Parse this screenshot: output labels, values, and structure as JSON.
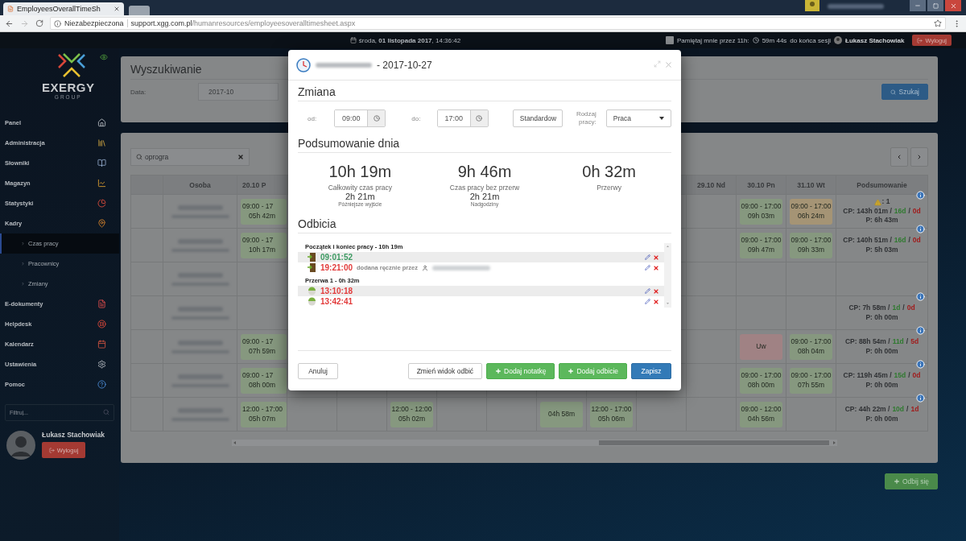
{
  "browser": {
    "tab_title": "EmployeesOverallTimeSh",
    "security": "Niezabezpieczona",
    "url_host": "support.xgg.com.pl",
    "url_path": "/humanresources/employeesoveralltimesheet.aspx"
  },
  "topbar": {
    "date": "środa, **01 listopada 2017**, 14:36:42",
    "remember_checked": false,
    "remember": "Pamiętaj mnie przez 11h:",
    "timer": "59m 44s",
    "timer_suffix": "do końca sesji",
    "user": "Łukasz Stachowiak",
    "logout": "Wyloguj"
  },
  "sidebar": {
    "brand": "EXERGY",
    "brand_sub": "GROUP",
    "items": [
      {
        "label": "Panel"
      },
      {
        "label": "Administracja"
      },
      {
        "label": "Słowniki"
      },
      {
        "label": "Magazyn"
      },
      {
        "label": "Statystyki"
      },
      {
        "label": "Kadry",
        "children": [
          {
            "label": "Czas pracy",
            "selected": true
          },
          {
            "label": "Pracownicy",
            "selected": false
          },
          {
            "label": "Zmiany",
            "selected": false
          }
        ]
      },
      {
        "label": "E-dokumenty"
      },
      {
        "label": "Helpdesk"
      },
      {
        "label": "Kalendarz"
      },
      {
        "label": "Ustawienia"
      },
      {
        "label": "Pomoc"
      }
    ],
    "filter_placeholder": "Filtruj...",
    "user": "Łukasz Stachowiak",
    "logout": "Wyloguj"
  },
  "search_panel": {
    "title": "Wyszukiwanie",
    "date_label": "Data:",
    "date_value": "2017-10",
    "search_button": "Szukaj"
  },
  "timesheet": {
    "filter_value": "oprogra",
    "columns": {
      "person": "Osoba",
      "first_day": "20.10 P",
      "last_days": [
        "29.10 Nd",
        "30.10 Pn",
        "31.10 Wt"
      ],
      "summary": "Podsumowanie"
    },
    "rows": [
      {
        "days": [
          {
            "kind": "work",
            "time": "09:00 - 17",
            "hours": "05h 42m"
          },
          {
            "kind": "empty"
          },
          {
            "kind": "empty"
          },
          {
            "kind": "empty"
          },
          {
            "kind": "empty"
          },
          {
            "kind": "empty"
          },
          {
            "kind": "empty"
          },
          {
            "kind": "empty"
          },
          {
            "kind": "empty"
          },
          {
            "kind": "empty"
          },
          {
            "kind": "work",
            "time": "09:00 - 17:00",
            "hours": "09h 03m"
          },
          {
            "kind": "late",
            "time": "09:00 - 17:00",
            "hours": "06h 24m"
          }
        ],
        "summary": {
          "warning": ": 1",
          "cp": "CP: 143h 01m /",
          "worked": "16d",
          "sep": "/",
          "absent": "0d",
          "p": "P: 6h 43m"
        }
      },
      {
        "days": [
          {
            "kind": "work",
            "time": "09:00 - 17",
            "hours": "10h 17m"
          },
          {
            "kind": "empty"
          },
          {
            "kind": "empty"
          },
          {
            "kind": "empty"
          },
          {
            "kind": "empty"
          },
          {
            "kind": "empty"
          },
          {
            "kind": "empty"
          },
          {
            "kind": "empty"
          },
          {
            "kind": "empty"
          },
          {
            "kind": "empty"
          },
          {
            "kind": "work",
            "time": "09:00 - 17:00",
            "hours": "09h 47m"
          },
          {
            "kind": "work",
            "time": "09:00 - 17:00",
            "hours": "09h 33m"
          }
        ],
        "summary": {
          "cp": "CP: 140h 51m /",
          "worked": "16d",
          "sep": "/",
          "absent": "0d",
          "p": "P: 5h 03m"
        }
      },
      {
        "days": [
          {
            "kind": "empty"
          },
          {
            "kind": "empty"
          },
          {
            "kind": "empty"
          },
          {
            "kind": "empty"
          },
          {
            "kind": "empty"
          },
          {
            "kind": "empty"
          },
          {
            "kind": "empty"
          },
          {
            "kind": "empty"
          },
          {
            "kind": "empty"
          },
          {
            "kind": "empty"
          },
          {
            "kind": "empty"
          },
          {
            "kind": "empty"
          }
        ]
      },
      {
        "days": [
          {
            "kind": "empty"
          },
          {
            "kind": "empty"
          },
          {
            "kind": "empty"
          },
          {
            "kind": "empty"
          },
          {
            "kind": "empty"
          },
          {
            "kind": "empty"
          },
          {
            "kind": "empty"
          },
          {
            "kind": "empty"
          },
          {
            "kind": "empty"
          },
          {
            "kind": "empty"
          },
          {
            "kind": "empty"
          },
          {
            "kind": "empty"
          }
        ],
        "summary": {
          "cp": "CP: 7h 58m /",
          "worked": "1d",
          "sep": "/",
          "absent": "0d",
          "p": "P: 0h 00m"
        }
      },
      {
        "days": [
          {
            "kind": "work",
            "time": "09:00 - 17",
            "hours": "07h 59m"
          },
          {
            "kind": "empty"
          },
          {
            "kind": "empty"
          },
          {
            "kind": "empty"
          },
          {
            "kind": "empty"
          },
          {
            "kind": "empty"
          },
          {
            "kind": "empty"
          },
          {
            "kind": "empty"
          },
          {
            "kind": "empty"
          },
          {
            "kind": "empty"
          },
          {
            "kind": "leave",
            "label": "Uw"
          },
          {
            "kind": "work",
            "time": "09:00 - 17:00",
            "hours": "08h 04m"
          }
        ],
        "summary": {
          "cp": "CP: 88h 54m /",
          "worked": "11d",
          "sep": "/",
          "absent": "5d",
          "p": "P: 0h 00m"
        }
      },
      {
        "days": [
          {
            "kind": "work",
            "time": "09:00 - 17",
            "hours": "08h 00m"
          },
          {
            "kind": "empty"
          },
          {
            "kind": "empty"
          },
          {
            "kind": "empty"
          },
          {
            "kind": "empty"
          },
          {
            "kind": "empty"
          },
          {
            "kind": "empty"
          },
          {
            "kind": "empty"
          },
          {
            "kind": "empty"
          },
          {
            "kind": "empty"
          },
          {
            "kind": "work",
            "time": "09:00 - 17:00",
            "hours": "08h 00m"
          },
          {
            "kind": "work",
            "time": "09:00 - 17:00",
            "hours": "07h 55m"
          }
        ],
        "summary": {
          "cp": "CP: 119h 45m /",
          "worked": "15d",
          "sep": "/",
          "absent": "0d",
          "p": "P: 0h 00m"
        }
      },
      {
        "days": [
          {
            "kind": "work",
            "time": "12:00 - 17:00",
            "hours": "05h 07m"
          },
          {
            "kind": "empty"
          },
          {
            "kind": "empty"
          },
          {
            "kind": "work",
            "time": "12:00 - 12:00",
            "hours": "05h 02m"
          },
          {
            "kind": "empty"
          },
          {
            "kind": "empty"
          },
          {
            "kind": "work",
            "hours": "04h 58m"
          },
          {
            "kind": "work",
            "time": "12:00 - 17:00",
            "hours": "05h 06m"
          },
          {
            "kind": "empty"
          },
          {
            "kind": "empty"
          },
          {
            "kind": "work",
            "time": "09:00 - 12:00",
            "hours": "04h 56m"
          },
          {
            "kind": "empty"
          }
        ],
        "summary": {
          "cp": "CP: 44h 22m /",
          "worked": "10d",
          "sep": "/",
          "absent": "1d",
          "p": "P: 0h 00m"
        }
      }
    ],
    "punch_button": "Odbij się"
  },
  "modal": {
    "title": "- 2017-10-27",
    "shift_heading": "Zmiana",
    "from_label": "od:",
    "from": "09:00",
    "to_label": "do:",
    "to": "17:00",
    "schedule": "Standardow",
    "work_type_label": "Rodzaj pracy:",
    "work_type": "Praca",
    "summary_heading": "Podsumowanie dnia",
    "stats": [
      {
        "value": "10h 19m",
        "label": "Całkowity czas pracy",
        "extra": "2h 21m",
        "extra_label": "Późniejsze wyjście"
      },
      {
        "value": "9h 46m",
        "label": "Czas pracy bez przerw",
        "extra": "2h 21m",
        "extra_label": "Nadgodziny"
      },
      {
        "value": "0h 32m",
        "label": "Przerwy"
      }
    ],
    "punches_heading": "Odbicia",
    "groups": [
      {
        "kind": "work",
        "title": "Początek i koniec pracy - 10h 19m",
        "entries": [
          {
            "time": "09:01:52",
            "color": "#3d9a62"
          },
          {
            "time": "19:21:00",
            "color": "#e23b3b",
            "note": "dodana ręcznie przez"
          }
        ]
      },
      {
        "kind": "break",
        "title": "Przerwa 1 - 0h 32m",
        "entries": [
          {
            "time": "13:10:18",
            "color": "#e23b3b"
          },
          {
            "time": "13:42:41",
            "color": "#e23b3b"
          }
        ]
      }
    ],
    "buttons": [
      {
        "label": "Anuluj",
        "kind": "cancel"
      },
      {
        "label": "Zmień widok odbić",
        "kind": "default"
      },
      {
        "label": "Dodaj notatkę",
        "kind": "add"
      },
      {
        "label": "Dodaj odbicie",
        "kind": "add"
      },
      {
        "label": "Zapisz",
        "kind": "primary"
      }
    ]
  }
}
